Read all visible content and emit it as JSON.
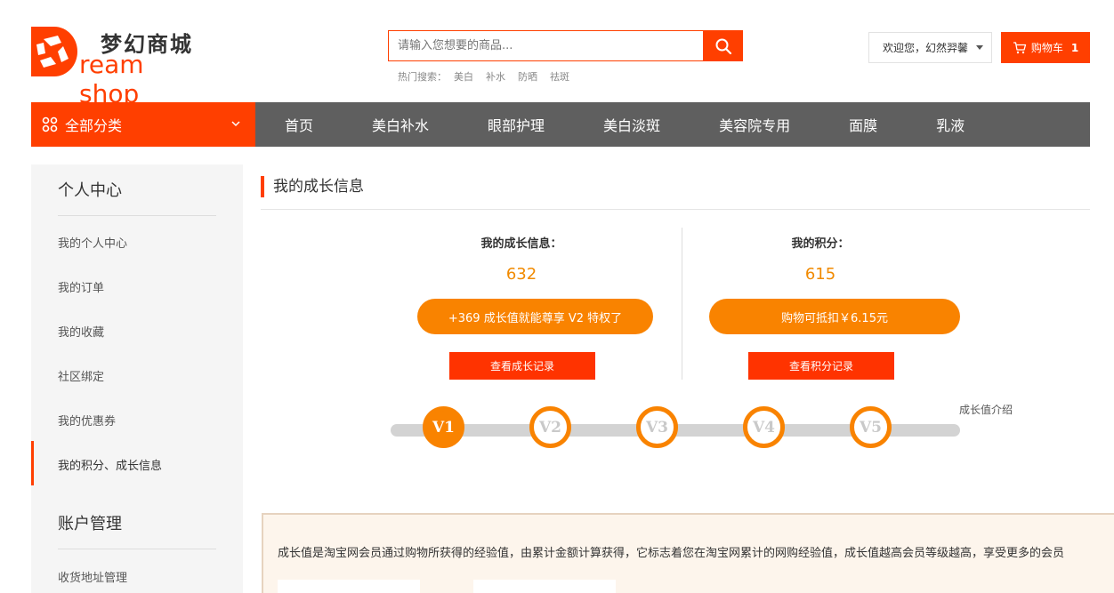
{
  "brand": {
    "cn": "梦幻商城",
    "en": "ream shop",
    "accent": "#ff3f00"
  },
  "search": {
    "placeholder": "请输入您想要的商品...",
    "hot_label": "热门搜索：",
    "hot_keywords": [
      "美白",
      "补水",
      "防晒",
      "祛斑"
    ]
  },
  "user": {
    "greeting": "欢迎您，幻然羿馨"
  },
  "cart": {
    "label": "购物车",
    "count": "1"
  },
  "nav": {
    "category_label": "全部分类",
    "items": [
      "首页",
      "美白补水",
      "眼部护理",
      "美白淡斑",
      "美容院专用",
      "面膜",
      "乳液"
    ]
  },
  "sidebar": {
    "section1_title": "个人中心",
    "section1_items": [
      "我的个人中心",
      "我的订单",
      "我的收藏",
      "社区绑定",
      "我的优惠券",
      "我的积分、成长信息"
    ],
    "section2_title": "账户管理",
    "section2_items": [
      "收货地址管理"
    ]
  },
  "main": {
    "title": "我的成长信息",
    "growth": {
      "label": "我的成长信息：",
      "value": "632",
      "pill": "+369 成长值就能尊享 V2 特权了",
      "button": "查看成长记录"
    },
    "points": {
      "label": "我的积分：",
      "value": "615",
      "pill": "购物可抵扣￥6.15元",
      "button": "查看积分记录"
    },
    "levels": [
      "V1",
      "V2",
      "V3",
      "V4",
      "V5"
    ],
    "current_level": "V1",
    "intro_link": "成长值介绍",
    "info_text": "成长值是淘宝网会员通过购物所获得的经验值，由累计金额计算获得，它标志着您在淘宝网累计的网购经验值，成长值越高会员等级越高，享受更多的会员"
  }
}
